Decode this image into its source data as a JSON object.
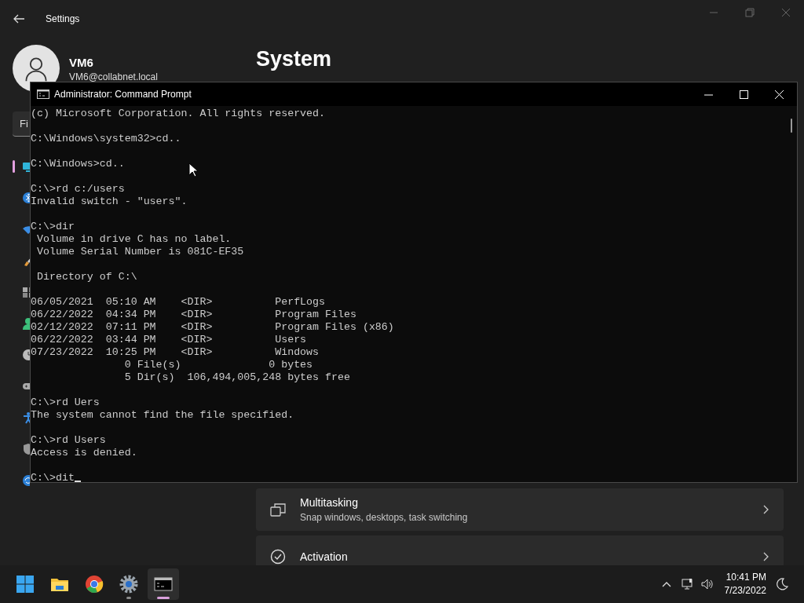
{
  "settings_window": {
    "title": "Settings",
    "user": {
      "name": "VM6",
      "email": "VM6@collabnet.local"
    },
    "search": {
      "placeholder": "Fi"
    },
    "sidebar": {
      "items": [
        {
          "kind": "system",
          "selected": true
        },
        {
          "kind": "bluetooth",
          "selected": false
        },
        {
          "kind": "network",
          "selected": false
        },
        {
          "kind": "personalization",
          "selected": false
        },
        {
          "kind": "apps",
          "selected": false
        },
        {
          "kind": "accounts",
          "selected": false
        },
        {
          "kind": "time",
          "selected": false
        },
        {
          "kind": "gaming",
          "selected": false
        },
        {
          "kind": "accessibility",
          "selected": false
        },
        {
          "kind": "privacy",
          "selected": false
        },
        {
          "kind": "update",
          "selected": false
        }
      ]
    },
    "page_title": "System",
    "cards": [
      {
        "kind": "multitasking",
        "title": "Multitasking",
        "subtitle": "Snap windows, desktops, task switching"
      },
      {
        "kind": "activation",
        "title": "Activation"
      }
    ]
  },
  "command_prompt": {
    "title": "Administrator: Command Prompt",
    "blocks": [
      [
        "(c) Microsoft Corporation. All rights reserved."
      ],
      [
        "C:\\Windows\\system32>cd.."
      ],
      [
        "C:\\Windows>cd.."
      ],
      [
        "C:\\>rd c:/users",
        "Invalid switch - \"users\"."
      ],
      [
        "C:\\>dir",
        " Volume in drive C has no label.",
        " Volume Serial Number is 081C-EF35"
      ],
      [
        " Directory of C:\\"
      ],
      [
        "06/05/2021  05:10 AM    <DIR>          PerfLogs",
        "06/22/2022  04:34 PM    <DIR>          Program Files",
        "02/12/2022  07:11 PM    <DIR>          Program Files (x86)",
        "06/22/2022  03:44 PM    <DIR>          Users",
        "07/23/2022  10:25 PM    <DIR>          Windows",
        "               0 File(s)              0 bytes",
        "               5 Dir(s)  106,494,005,248 bytes free"
      ],
      [
        "C:\\>rd Uers",
        "The system cannot find the file specified."
      ],
      [
        "C:\\>rd Users",
        "Access is denied."
      ],
      [
        "C:\\>dit"
      ]
    ]
  },
  "taskbar": {
    "apps": [
      {
        "kind": "start",
        "running": false,
        "selected": false
      },
      {
        "kind": "explorer",
        "running": false,
        "selected": false
      },
      {
        "kind": "browser",
        "running": false,
        "selected": false
      },
      {
        "kind": "settings",
        "running": true,
        "selected": false
      },
      {
        "kind": "terminal",
        "running": true,
        "selected": true
      }
    ],
    "time": "10:41 PM",
    "date": "7/23/2022"
  }
}
